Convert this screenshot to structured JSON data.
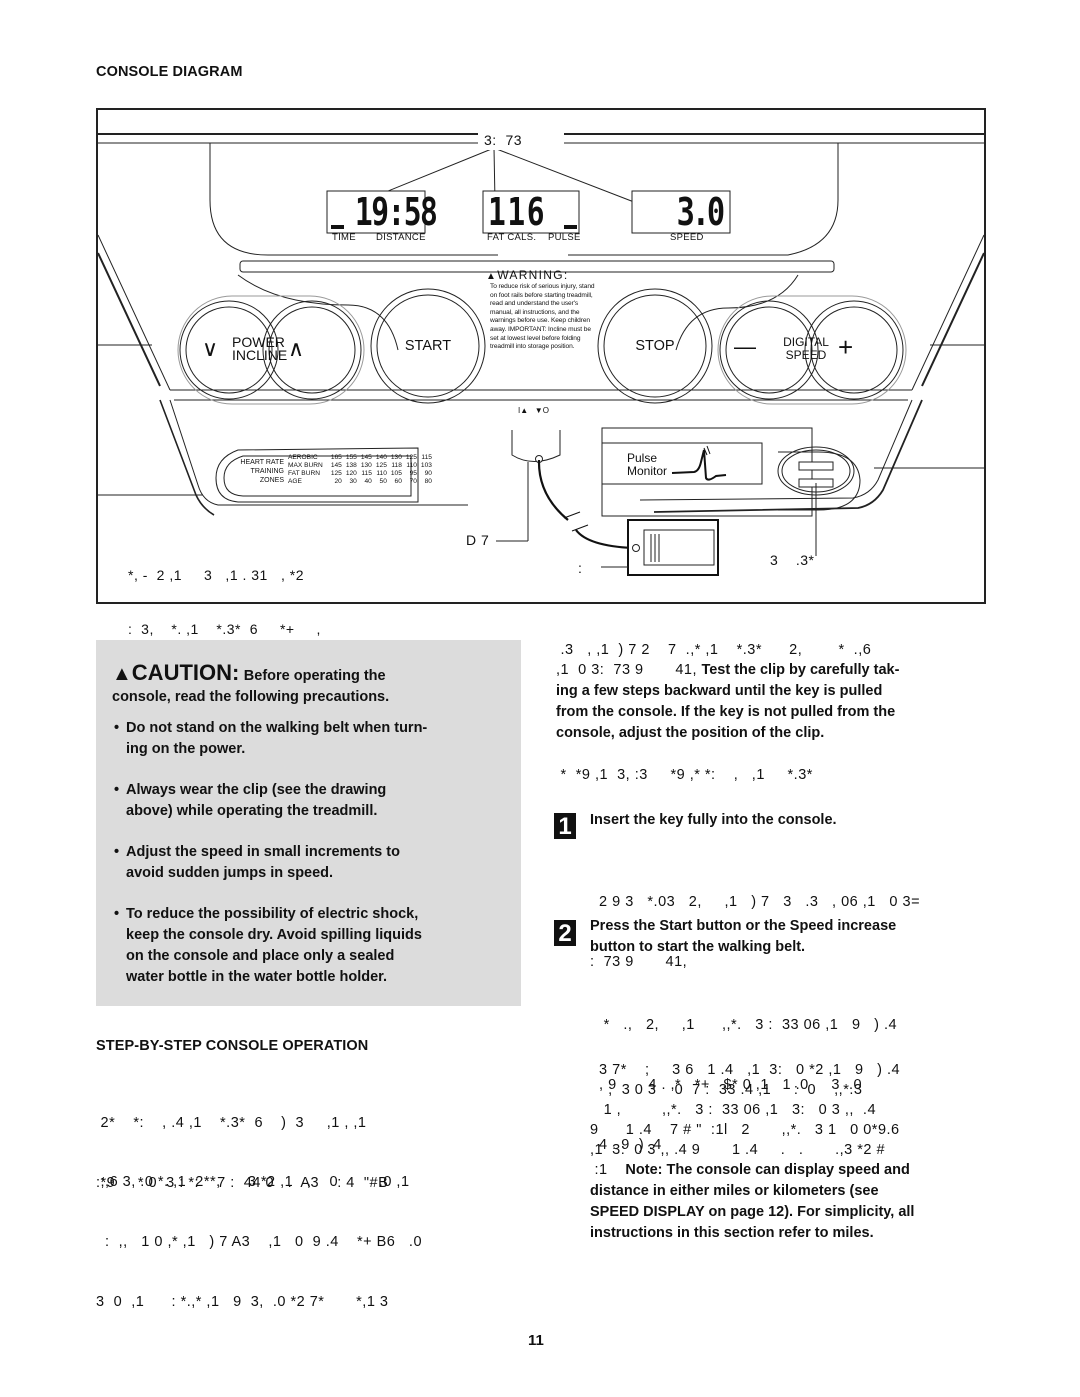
{
  "page": {
    "section_title": "CONSOLE DIAGRAM",
    "page_number": "11"
  },
  "diagram": {
    "display_callout": "3:  73",
    "displays": [
      {
        "value": "19:58",
        "labels": [
          "TIME",
          "DISTANCE"
        ]
      },
      {
        "value": "116",
        "labels": [
          "FAT CALS.",
          "PULSE"
        ]
      },
      {
        "value": "3.0",
        "labels": [
          "SPEED"
        ]
      }
    ],
    "warning": {
      "title": "WARNING:",
      "body": "To reduce risk of serious injury, stand on foot rails before starting treadmill, read and understand the user's manual, all instructions, and the warnings before use. Keep children away.",
      "important": "IMPORTANT: Incline must be set at lowest level before folding treadmill into storage position."
    },
    "buttons": {
      "incline_line1": "POWER",
      "incline_line2": "INCLINE",
      "incline_down": "∨",
      "incline_up": "∧",
      "start": "START",
      "stop": "STOP",
      "speed_line1": "DIGITAL",
      "speed_line2": "SPEED",
      "speed_down": "—",
      "speed_up": "+"
    },
    "key_slot_labels": "I▲   ▼O",
    "heart_rate": {
      "title_line1": "HEART RATE",
      "title_line2": "TRAINING ZONES",
      "rows": [
        {
          "label": "AEROBIC",
          "values": [
            "165",
            "155",
            "145",
            "140",
            "130",
            "125",
            "115"
          ]
        },
        {
          "label": "MAX BURN",
          "values": [
            "145",
            "138",
            "130",
            "125",
            "118",
            "110",
            "103"
          ]
        },
        {
          "label": "FAT BURN",
          "values": [
            "125",
            "120",
            "115",
            "110",
            "105",
            "95",
            "90"
          ]
        },
        {
          "label": "AGE",
          "values": [
            "20",
            "30",
            "40",
            "50",
            "60",
            "70",
            "80"
          ]
        }
      ]
    },
    "pulse_monitor_line1": "Pulse",
    "pulse_monitor_line2": "Monitor",
    "callout_left_line1": "*, -  2 ,1     3   ,1 . 31   , *2",
    "callout_left_line2": ":  3,    *. ,1    *.3*  6     *+     ,",
    "callout_key": "D 7",
    "callout_clip": ":",
    "callout_sensor": "3    .3*"
  },
  "caution": {
    "title": "CAUTION:",
    "title_rest": "Before operating the",
    "line2": "console, read the following precautions.",
    "bullets": [
      [
        "Do not stand on the walking belt when turn-",
        "ing on the power."
      ],
      [
        "Always wear the clip (see the drawing",
        "above) while operating the treadmill."
      ],
      [
        "Adjust the speed in small increments to",
        "avoid sudden jumps in speed."
      ],
      [
        "To reduce the possibility of electric shock,",
        "keep the console dry. Avoid spilling liquids",
        "on the console and place only a sealed",
        "water bottle in the water bottle holder."
      ]
    ]
  },
  "step_section": {
    "title": "STEP-BY-STEP CONSOLE OPERATION",
    "para1": [
      " 2*    *:    , .4 ,1    *.3*  6    )  3     ,1 , ,1",
      ":*9     * 0  3 : *:    7 :  44 0   .  A3    : 4  \"#B"
    ],
    "para2": [
      " ;,6 3, .0 *. ,1  2**,      3 *2 ,1   ,    0         .0 ,1",
      "  :  ,,   1 0 ,* ,1   ) 7 A3    ,1   0  9 .4    *+ B6   .0",
      "3  0  ,1      : *.,* ,1   9  3,  .0 *2 7*       *,1 3"
    ]
  },
  "right_col": {
    "para1_garbled": [
      " .3   , ,1  ) 7 2    7  .,* ,1    *.3*      2,        *  .,6",
      ",1  0 3:  73 9       41,"
    ],
    "para1_bold": [
      "Test the clip by carefully tak-",
      "ing a few steps backward until the key is pulled",
      "from the console. If the key is not pulled from the",
      "console, adjust the position of the clip."
    ],
    "subhead_garbled": " *  *9 ,1  3, :3     *9 ,* *:    ,   ,1     *.3*",
    "steps": [
      {
        "number": "1",
        "title": [
          "Insert the key fully into the console."
        ],
        "body": [
          "  2 9 3   *.03   2,     ,1   ) 7   3   .3   , 06 ,1   0 3=",
          ":  73 9       41,"
        ]
      },
      {
        "number": "2",
        "title": [
          "Press the Start button or the Speed increase",
          "button to start the walking belt."
        ],
        "body": [
          "   *   .,   2,     ,1      ,,*.   3 :  33 06 ,1   9   ) .4",
          "  , 9       4 . ,*   *+   $* 0 ,1   1 .0     3  .0",
          "  4 . 9  ) .4"
        ]
      }
    ],
    "para3": [
      "  3 7*    ;     3 6   1 .4   ,1  3:   0 *2 ,1   9   ) .4",
      "    ,  3 0 3    0  7 :  33 .4 ,1     :  0    ,,*.3",
      "   1 ,         ,,*.   3 :  33 06 ,1   3:   0 3 ,,  .4",
      "9      1 .4    7 # \"  :1l   2       ,,*.   3 1   0 0*9.6",
      ",1  3:  0 3 ,, .4 9       1 .4     .   .       .,3 *2 #"
    ],
    "note_prefix": " :1",
    "note": [
      "Note: The console can display speed and",
      "distance in either miles or kilometers (see",
      "SPEED DISPLAY on page 12). For simplicity, all",
      "instructions in this section refer to miles."
    ]
  }
}
